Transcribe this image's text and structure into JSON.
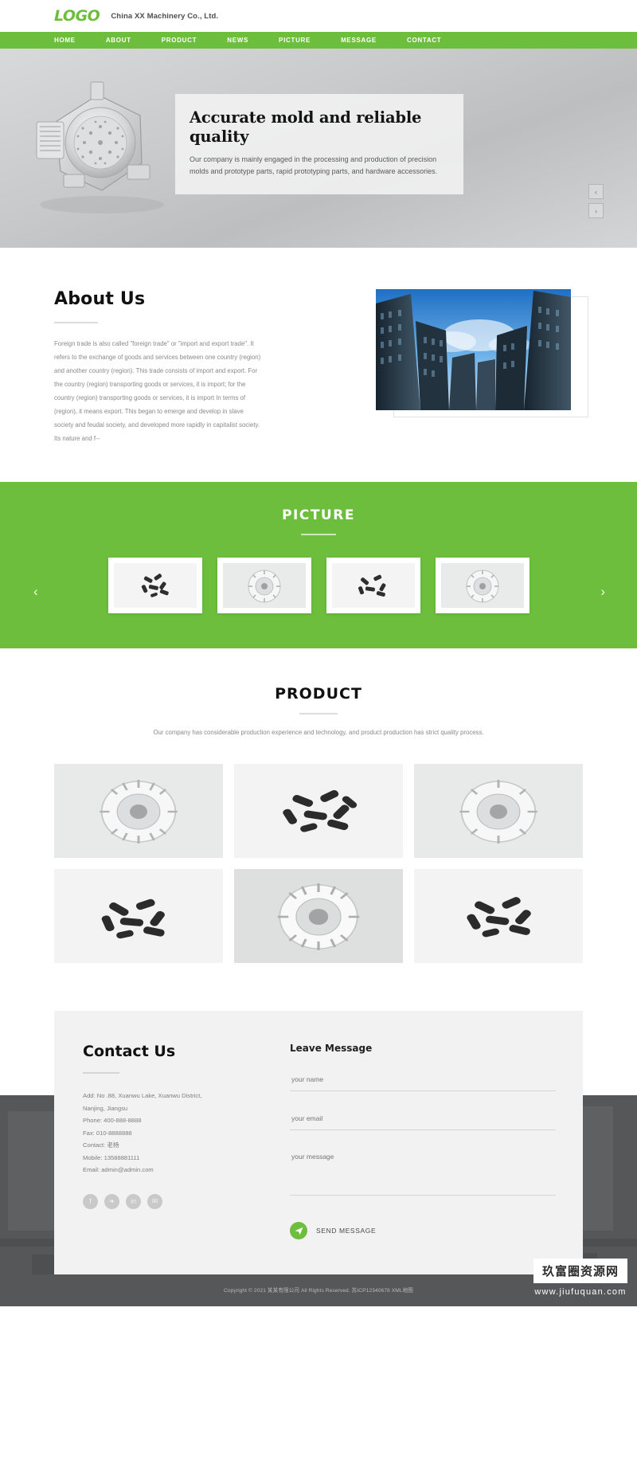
{
  "header": {
    "logo_text": "LOGO",
    "company_name": "China XX Machinery Co., Ltd."
  },
  "nav": {
    "items": [
      {
        "label": "HOME"
      },
      {
        "label": "ABOUT"
      },
      {
        "label": "PRODUCT"
      },
      {
        "label": "NEWS"
      },
      {
        "label": "PICTURE"
      },
      {
        "label": "MESSAGE"
      },
      {
        "label": "CONTACT"
      }
    ]
  },
  "hero": {
    "title": "Accurate mold and reliable quality",
    "description": "Our company is mainly engaged in the processing and production of precision molds and prototype parts, rapid prototyping parts, and hardware accessories.",
    "prev_arrow": "‹",
    "next_arrow": "›"
  },
  "about": {
    "title": "About Us",
    "text": "Foreign trade is also called \"foreign trade\" or \"import and export trade\". It refers to the exchange of goods and services between one country (region) and another country (region). This trade consists of import and export. For the country (region) transporting goods or services, it is import; for the country (region) transporting goods or services, it is import In terms of (region), it means export. This began to emerge and develop in slave society and feudal society, and developed more rapidly in capitalist society. Its nature and f--"
  },
  "picture": {
    "title": "PICTURE",
    "prev_arrow": "‹",
    "next_arrow": "›",
    "slides": [
      {
        "alt": "screws-scattered"
      },
      {
        "alt": "gear-wheel"
      },
      {
        "alt": "screws-scattered"
      },
      {
        "alt": "gear-wheel"
      }
    ]
  },
  "product": {
    "title": "PRODUCT",
    "subtitle": "Our company has considerable production experience and technology, and product production has strict quality process.",
    "items": [
      {
        "alt": "gear-wheel"
      },
      {
        "alt": "screws-scattered"
      },
      {
        "alt": "gear-wheel"
      },
      {
        "alt": "screws-scattered"
      },
      {
        "alt": "gear-wheel"
      },
      {
        "alt": "screws-scattered"
      }
    ]
  },
  "contact": {
    "title": "Contact Us",
    "address_line1": "Add: No .88, Xuanwu Lake, Xuanwu District,",
    "address_line2": "Nanjing, Jiangsu",
    "phone": "Phone: 400-888-8888",
    "fax": "Fax: 010-8888888",
    "contact_person": "Contact: 老杨",
    "mobile": "Mobile: 13588881111",
    "email": "Email: admin@admin.com",
    "socials": [
      {
        "name": "facebook",
        "glyph": "f"
      },
      {
        "name": "twitter",
        "glyph": "❧"
      },
      {
        "name": "linkedin",
        "glyph": "in"
      },
      {
        "name": "email",
        "glyph": "✉"
      }
    ]
  },
  "message_form": {
    "title": "Leave Message",
    "name_placeholder": "your name",
    "email_placeholder": "your email",
    "message_placeholder": "your message",
    "send_label": "SEND MESSAGE",
    "send_icon": "➤"
  },
  "footer": {
    "copyright": "Copyright © 2021 某某有限公司 All Rights Reserved.  苏ICP12340678  XML地图"
  },
  "watermark": {
    "main": "玖富圈资源网",
    "sub": "www.jiufuquan.com"
  },
  "colors": {
    "accent": "#6cbe3c",
    "footer_bg": "#555758",
    "text_muted": "#8a8a8a"
  }
}
